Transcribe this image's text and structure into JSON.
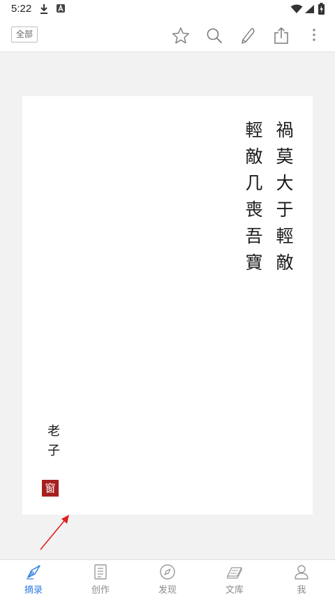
{
  "status_bar": {
    "time": "5:22"
  },
  "toolbar": {
    "filter_label": "全部",
    "icons": [
      "star-icon",
      "search-icon",
      "pen-icon",
      "share-icon",
      "more-vert-icon"
    ]
  },
  "card": {
    "poem_columns": [
      "禍莫大于輕敵",
      "輕敵几喪吾寶"
    ],
    "author": "老子",
    "seal_char": "窗"
  },
  "bottom_nav": {
    "items": [
      {
        "label": "摘录",
        "icon": "fountain-pen-icon",
        "active": true
      },
      {
        "label": "创作",
        "icon": "notebook-icon",
        "active": false
      },
      {
        "label": "发现",
        "icon": "compass-icon",
        "active": false
      },
      {
        "label": "文库",
        "icon": "books-icon",
        "active": false
      },
      {
        "label": "我",
        "icon": "person-icon",
        "active": false
      }
    ]
  },
  "colors": {
    "accent": "#2b7de0",
    "seal": "#a5201f",
    "annotation": "#e02020"
  }
}
